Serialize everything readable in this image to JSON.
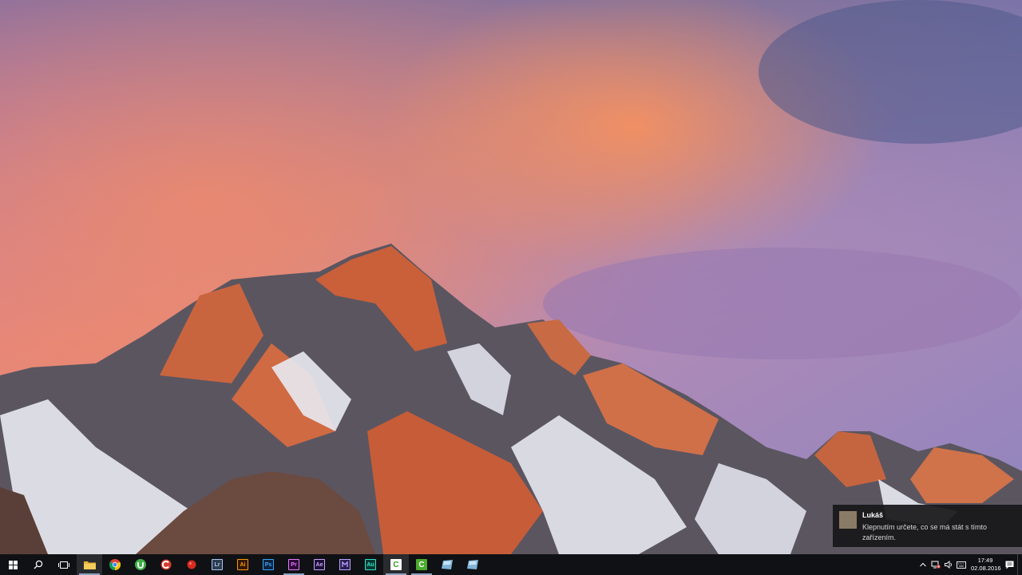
{
  "notification": {
    "title": "Lukáš",
    "text": "Klepnutím určete, co se má stát s tímto zařízením."
  },
  "taskbar": {
    "start_icon": "windows-logo-icon",
    "search_icon": "search-icon",
    "task_view_icon": "task-view-icon",
    "pinned_apps": [
      {
        "name": "file-explorer",
        "label": "",
        "color": "#e8b43a"
      },
      {
        "name": "chrome",
        "label": "",
        "color": "#db4437"
      },
      {
        "name": "utorrent",
        "label": "",
        "color": "#3fae49"
      },
      {
        "name": "ccleaner",
        "label": "",
        "color": "#d73b2e"
      },
      {
        "name": "red-app",
        "label": "",
        "color": "#d62b1f"
      },
      {
        "name": "lightroom",
        "label": "Lr",
        "color": "#2e3c4f"
      },
      {
        "name": "illustrator",
        "label": "Ai",
        "color": "#33170a"
      },
      {
        "name": "photoshop",
        "label": "Ps",
        "color": "#0f2340"
      },
      {
        "name": "premiere",
        "label": "Pr",
        "color": "#2a0a36"
      },
      {
        "name": "after-effects",
        "label": "Ae",
        "color": "#1c1236"
      },
      {
        "name": "media-encoder",
        "label": "",
        "color": "#2a1e52"
      },
      {
        "name": "audition",
        "label": "Au",
        "color": "#0b3a33"
      },
      {
        "name": "camtasia",
        "label": "C",
        "color": "#ffffff"
      },
      {
        "name": "camtasia-recorder",
        "label": "C",
        "color": "#4caa2d"
      },
      {
        "name": "app-blue-1",
        "label": "",
        "color": "#7fb4d8"
      },
      {
        "name": "app-blue-2",
        "label": "",
        "color": "#7fb4d8"
      }
    ]
  },
  "tray": {
    "time": "17:49",
    "date": "02.08.2016"
  }
}
